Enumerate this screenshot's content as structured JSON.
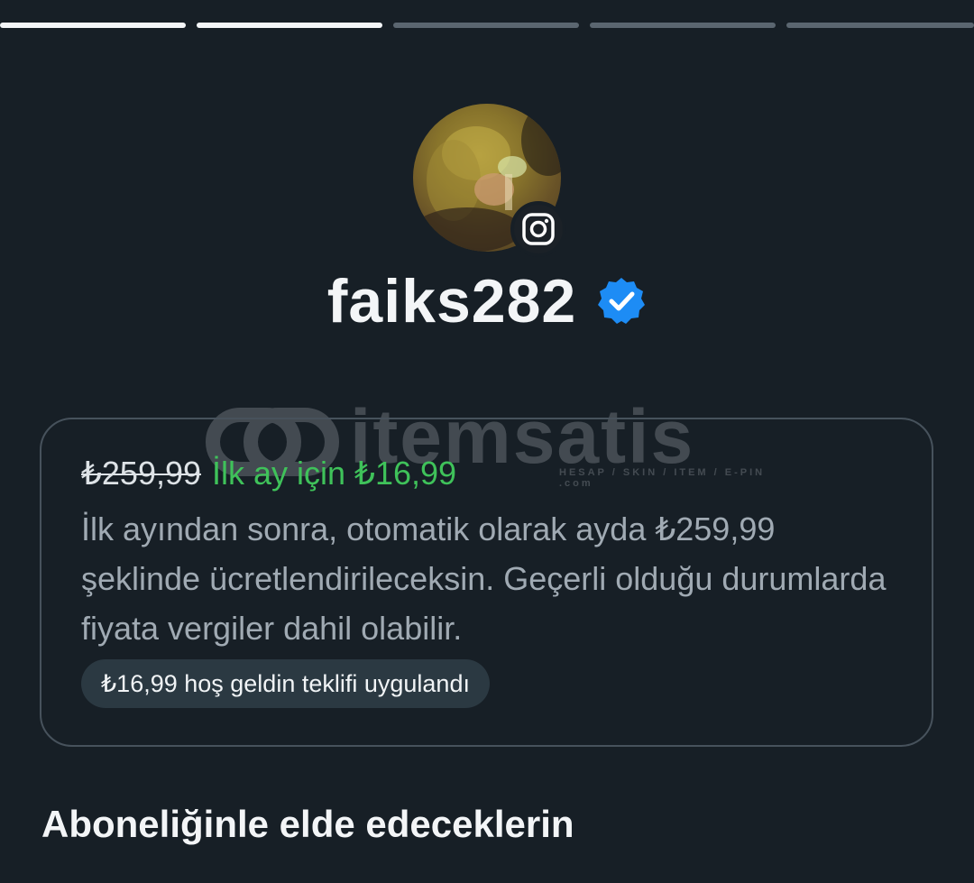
{
  "progress": {
    "segments": 5,
    "completed": 2
  },
  "profile": {
    "username": "faiks282",
    "verified": true,
    "badge_icon": "instagram-icon",
    "verified_icon": "verified-badge-icon"
  },
  "watermark": {
    "text": "itemsatis",
    "subtext": "HESAP / SKIN / ITEM / E-PIN .com"
  },
  "offer": {
    "old_price": "₺259,99",
    "promo_text": "İlk ay için ₺16,99",
    "description": "İlk ayından sonra, otomatik olarak ayda ₺259,99 şeklinde ücretlendirileceksin. Geçerli olduğu durumlarda fiyata vergiler dahil olabilir.",
    "chip_text": "₺16,99 hoş geldin teklifi uygulandı"
  },
  "section": {
    "title": "Aboneliğinle elde edeceklerin"
  },
  "colors": {
    "background": "#171f26",
    "promo_green": "#3fc25a",
    "verified_blue": "#1d8cf5",
    "card_border": "#47525c",
    "chip_bg": "#2b3942"
  }
}
